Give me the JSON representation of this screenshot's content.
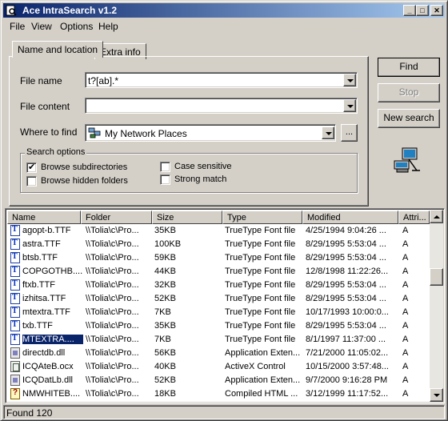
{
  "window": {
    "title": "Ace IntraSearch v1.2",
    "buttons": {
      "minimize": "_",
      "maximize": "□",
      "close": "✕"
    }
  },
  "menu": [
    "File",
    "View",
    "Options",
    "Help"
  ],
  "tabs": [
    {
      "label": "Name and location",
      "active": true
    },
    {
      "label": "Extra info",
      "active": false
    }
  ],
  "form": {
    "file_name_label": "File name",
    "file_name_value": "t?[ab].*",
    "file_content_label": "File content",
    "file_content_value": "",
    "where_label": "Where to find",
    "where_value": "My Network Places",
    "browse_label": "..."
  },
  "search_options": {
    "legend": "Search options",
    "browse_subdirectories": {
      "label": "Browse subdirectories",
      "checked": true
    },
    "browse_hidden": {
      "label": "Browse hidden folders",
      "checked": false
    },
    "case_sensitive": {
      "label": "Case sensitive",
      "checked": false
    },
    "strong_match": {
      "label": "Strong match",
      "checked": false
    }
  },
  "actions": {
    "find": "Find",
    "stop": "Stop",
    "new_search": "New search"
  },
  "columns": [
    "Name",
    "Folder",
    "Size",
    "Type",
    "Modified",
    "Attri..."
  ],
  "rows": [
    {
      "icon": "ttf",
      "name": "agopt-b.TTF",
      "folder": "\\\\Tolia\\c\\Pro...",
      "size": "35KB",
      "type": "TrueType Font file",
      "modified": "4/25/1994 9:04:26 ...",
      "attr": "A",
      "selected": false
    },
    {
      "icon": "ttf",
      "name": "astra.TTF",
      "folder": "\\\\Tolia\\c\\Pro...",
      "size": "100KB",
      "type": "TrueType Font file",
      "modified": "8/29/1995 5:53:04 ...",
      "attr": "A",
      "selected": false
    },
    {
      "icon": "ttf",
      "name": "btsb.TTF",
      "folder": "\\\\Tolia\\c\\Pro...",
      "size": "59KB",
      "type": "TrueType Font file",
      "modified": "8/29/1995 5:53:04 ...",
      "attr": "A",
      "selected": false
    },
    {
      "icon": "ttf",
      "name": "COPGOTHB....",
      "folder": "\\\\Tolia\\c\\Pro...",
      "size": "44KB",
      "type": "TrueType Font file",
      "modified": "12/8/1998 11:22:26...",
      "attr": "A",
      "selected": false
    },
    {
      "icon": "ttf",
      "name": "ftxb.TTF",
      "folder": "\\\\Tolia\\c\\Pro...",
      "size": "32KB",
      "type": "TrueType Font file",
      "modified": "8/29/1995 5:53:04 ...",
      "attr": "A",
      "selected": false
    },
    {
      "icon": "ttf",
      "name": "izhitsa.TTF",
      "folder": "\\\\Tolia\\c\\Pro...",
      "size": "52KB",
      "type": "TrueType Font file",
      "modified": "8/29/1995 5:53:04 ...",
      "attr": "A",
      "selected": false
    },
    {
      "icon": "ttf",
      "name": "mtextra.TTF",
      "folder": "\\\\Tolia\\c\\Pro...",
      "size": "7KB",
      "type": "TrueType Font file",
      "modified": "10/17/1993 10:00:0...",
      "attr": "A",
      "selected": false
    },
    {
      "icon": "ttf",
      "name": "txb.TTF",
      "folder": "\\\\Tolia\\c\\Pro...",
      "size": "35KB",
      "type": "TrueType Font file",
      "modified": "8/29/1995 5:53:04 ...",
      "attr": "A",
      "selected": false
    },
    {
      "icon": "ttf",
      "name": "MTEXTRA....",
      "folder": "\\\\Tolia\\c\\Pro...",
      "size": "7KB",
      "type": "TrueType Font file",
      "modified": "8/1/1997 11:37:00 ...",
      "attr": "A",
      "selected": true
    },
    {
      "icon": "dll",
      "name": "directdb.dll",
      "folder": "\\\\Tolia\\c\\Pro...",
      "size": "56KB",
      "type": "Application Exten...",
      "modified": "7/21/2000 11:05:02...",
      "attr": "A",
      "selected": false
    },
    {
      "icon": "ocx",
      "name": "ICQAteB.ocx",
      "folder": "\\\\Tolia\\c\\Pro...",
      "size": "40KB",
      "type": "ActiveX Control",
      "modified": "10/15/2000 3:57:48...",
      "attr": "A",
      "selected": false
    },
    {
      "icon": "dll",
      "name": "ICQDatLb.dll",
      "folder": "\\\\Tolia\\c\\Pro...",
      "size": "52KB",
      "type": "Application Exten...",
      "modified": "9/7/2000 9:16:28 PM",
      "attr": "A",
      "selected": false
    },
    {
      "icon": "chm",
      "name": "NMWHITEB....",
      "folder": "\\\\Tolia\\c\\Pro...",
      "size": "18KB",
      "type": "Compiled HTML ...",
      "modified": "3/12/1999 11:17:52...",
      "attr": "A",
      "selected": false
    }
  ],
  "status": "Found 120",
  "colors": {
    "title_start": "#0a246a",
    "title_end": "#a6caf0",
    "selection": "#0a246a",
    "face": "#d4d0c8"
  },
  "icons": [
    "app-search-icon",
    "network-places-icon",
    "network-computer-icon",
    "font-file-icon",
    "dll-file-icon",
    "ocx-file-icon",
    "chm-help-file-icon"
  ]
}
